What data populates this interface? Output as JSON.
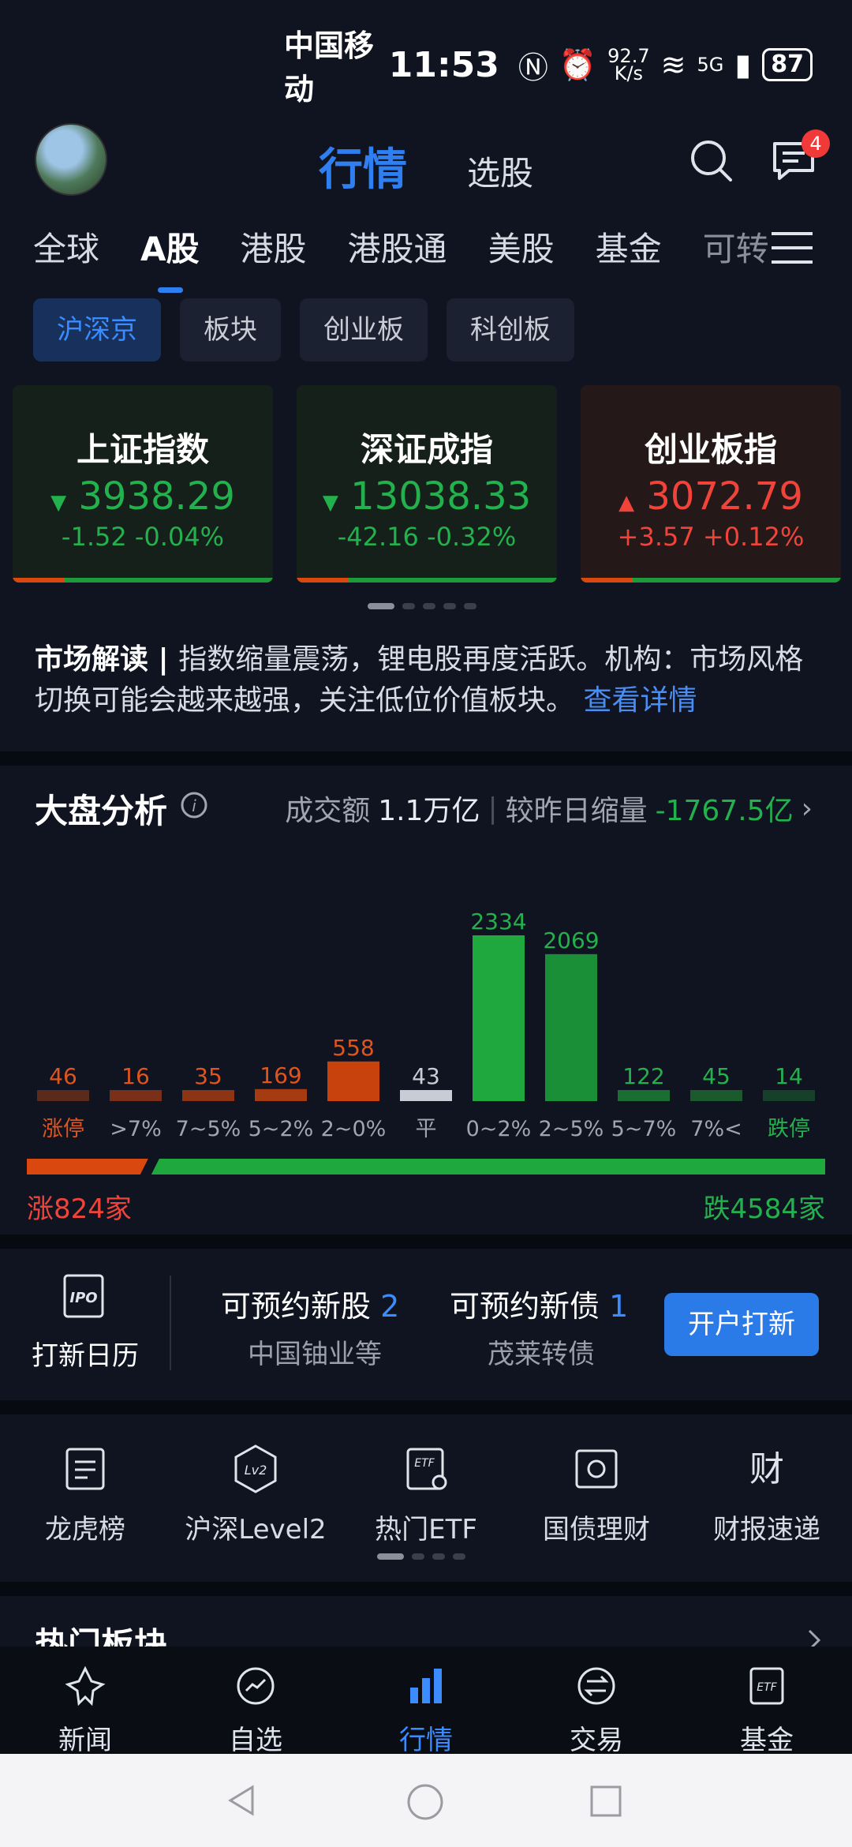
{
  "status_bar": {
    "carrier": "中国移动",
    "time": "11:53",
    "net_speed_top": "92.7",
    "net_speed_bottom": "K/s",
    "signal": "5G",
    "battery": "87"
  },
  "header": {
    "title": "行情",
    "subtitle": "选股",
    "message_badge": "4"
  },
  "tabs": [
    "全球",
    "A股",
    "港股",
    "港股通",
    "美股",
    "基金",
    "可转"
  ],
  "subtabs": [
    "沪深京",
    "板块",
    "创业板",
    "科创板"
  ],
  "indices": [
    {
      "name": "上证指数",
      "value": "3938.29",
      "change": "-1.52  -0.04%",
      "arrow": "▼"
    },
    {
      "name": "深证成指",
      "value": "13038.33",
      "change": "-42.16  -0.32%",
      "arrow": "▼"
    },
    {
      "name": "创业板指",
      "value": "3072.79",
      "change": "+3.57  +0.12%",
      "arrow": "▲"
    }
  ],
  "market_read": {
    "label": "市场解读",
    "text": "指数缩量震荡，锂电股再度活跃。机构：市场风格切换可能会越来越强，关注低位价值板块。",
    "link": "查看详情"
  },
  "market_analysis": {
    "title": "大盘分析",
    "turnover_label": "成交额",
    "turnover_value": "1.1万亿",
    "compare_label": "较昨日缩量",
    "compare_value": "-1767.5亿",
    "up_count": "涨824家",
    "down_count": "跌4584家"
  },
  "chart_data": {
    "type": "bar",
    "categories": [
      "涨停",
      ">7%",
      "7~5%",
      "5~2%",
      "2~0%",
      "平",
      "0~2%",
      "2~5%",
      "5~7%",
      "7%<",
      "跌停"
    ],
    "values": [
      46,
      16,
      35,
      169,
      558,
      43,
      2334,
      2069,
      122,
      45,
      14
    ],
    "up_ratio": 0.152
  },
  "ipo": {
    "label": "打新日历",
    "stock_title": "可预约新股",
    "stock_count": "2",
    "stock_sub": "中国铀业等",
    "bond_title": "可预约新债",
    "bond_count": "1",
    "bond_sub": "茂莱转债",
    "button": "开户打新"
  },
  "tools": [
    {
      "label": "龙虎榜",
      "icon": "dragon-tiger-list-icon"
    },
    {
      "label": "沪深Level2",
      "icon": "level2-icon"
    },
    {
      "label": "热门ETF",
      "icon": "etf-icon"
    },
    {
      "label": "国债理财",
      "icon": "treasury-icon"
    },
    {
      "label": "财报速递",
      "icon": "earnings-icon"
    }
  ],
  "hot_sectors": {
    "title": "热门板块"
  },
  "bottom_nav": [
    "新闻",
    "自选",
    "行情",
    "交易",
    "基金"
  ],
  "colors": {
    "up": "#f0443a",
    "down": "#23b14d",
    "accent": "#2f7ff0"
  }
}
